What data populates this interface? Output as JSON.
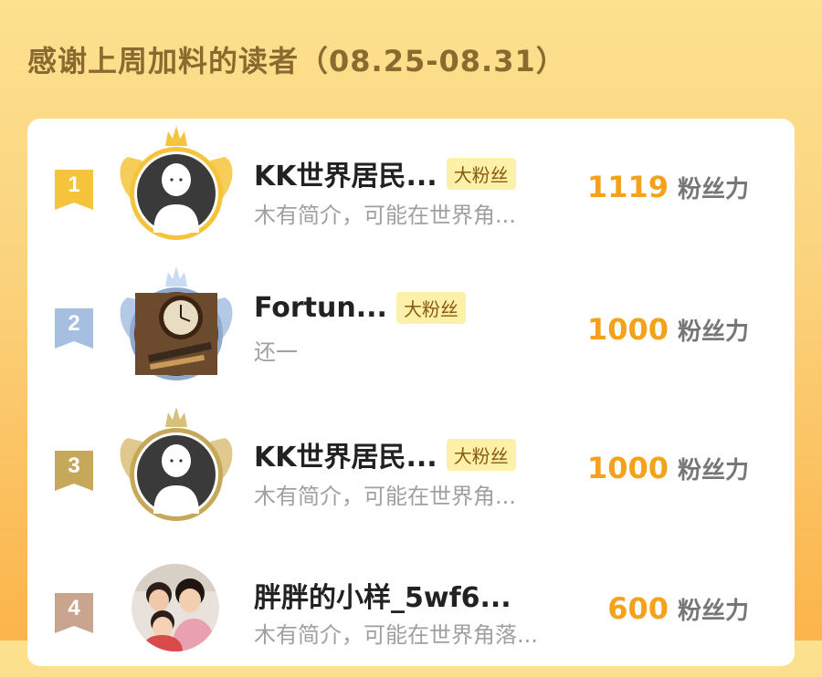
{
  "header": {
    "title": "感谢上周加料的读者（08.25-08.31）"
  },
  "colors": {
    "accent_orange": "#f4a11c",
    "gold": "#f5c43c",
    "silver_blue": "#a6bfe0",
    "bronze": "#c6a85a",
    "fourth": "#c9a48e"
  },
  "readers": [
    {
      "rank": "1",
      "name": "KK世界居民...",
      "badge": "大粉丝",
      "bio": "木有简介，可能在世界角...",
      "score": "1119",
      "score_unit": "粉丝力",
      "avatar_icon": "default-person-icon"
    },
    {
      "rank": "2",
      "name": "Fortun...",
      "badge": "大粉丝",
      "bio": "还一",
      "score": "1000",
      "score_unit": "粉丝力",
      "avatar_icon": "clock-photo"
    },
    {
      "rank": "3",
      "name": "KK世界居民...",
      "badge": "大粉丝",
      "bio": "木有简介，可能在世界角...",
      "score": "1000",
      "score_unit": "粉丝力",
      "avatar_icon": "default-person-icon"
    },
    {
      "rank": "4",
      "name": "胖胖的小样_5wf6...",
      "badge": "",
      "bio": "木有简介，可能在世界角落...",
      "score": "600",
      "score_unit": "粉丝力",
      "avatar_icon": "family-photo"
    }
  ]
}
